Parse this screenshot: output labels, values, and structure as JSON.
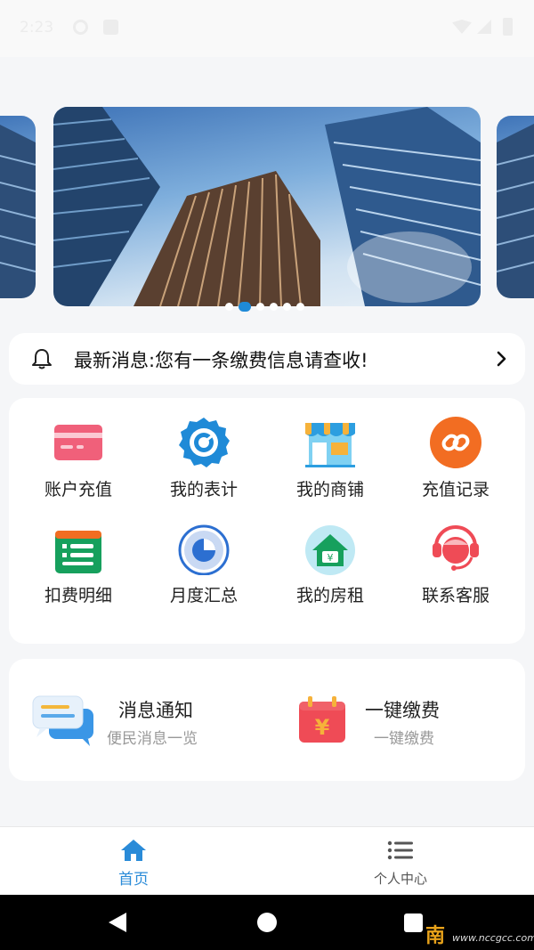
{
  "status_bar": {
    "time": "2:23"
  },
  "banner": {
    "dot_count": 6,
    "active_index": 1
  },
  "notice": {
    "text": "最新消息:您有一条缴费信息请查收!"
  },
  "grid": {
    "items": [
      {
        "label": "账户充值",
        "icon": "card-icon"
      },
      {
        "label": "我的表计",
        "icon": "meter-gear-icon"
      },
      {
        "label": "我的商铺",
        "icon": "shop-icon"
      },
      {
        "label": "充值记录",
        "icon": "link-record-icon"
      },
      {
        "label": "扣费明细",
        "icon": "deduction-list-icon"
      },
      {
        "label": "月度汇总",
        "icon": "pie-summary-icon"
      },
      {
        "label": "我的房租",
        "icon": "house-rent-icon"
      },
      {
        "label": "联系客服",
        "icon": "customer-service-icon"
      }
    ]
  },
  "quick": {
    "notice": {
      "title": "消息通知",
      "subtitle": "便民消息一览",
      "icon": "chat-bubbles-icon"
    },
    "pay": {
      "title": "一键缴费",
      "subtitle": "一键缴费",
      "icon": "payment-calendar-icon"
    }
  },
  "tabs": {
    "home": {
      "label": "首页",
      "icon": "home-icon"
    },
    "profile": {
      "label": "个人中心",
      "icon": "list-icon"
    }
  },
  "watermark": {
    "mark": "南",
    "url": "www.nccgcc.com"
  },
  "colors": {
    "accent": "#2a8bd8",
    "card_pink": "#f0607a",
    "gear_blue": "#1f8ad7",
    "orange": "#f26d22",
    "green": "#16a05d",
    "red": "#ef4b56"
  }
}
